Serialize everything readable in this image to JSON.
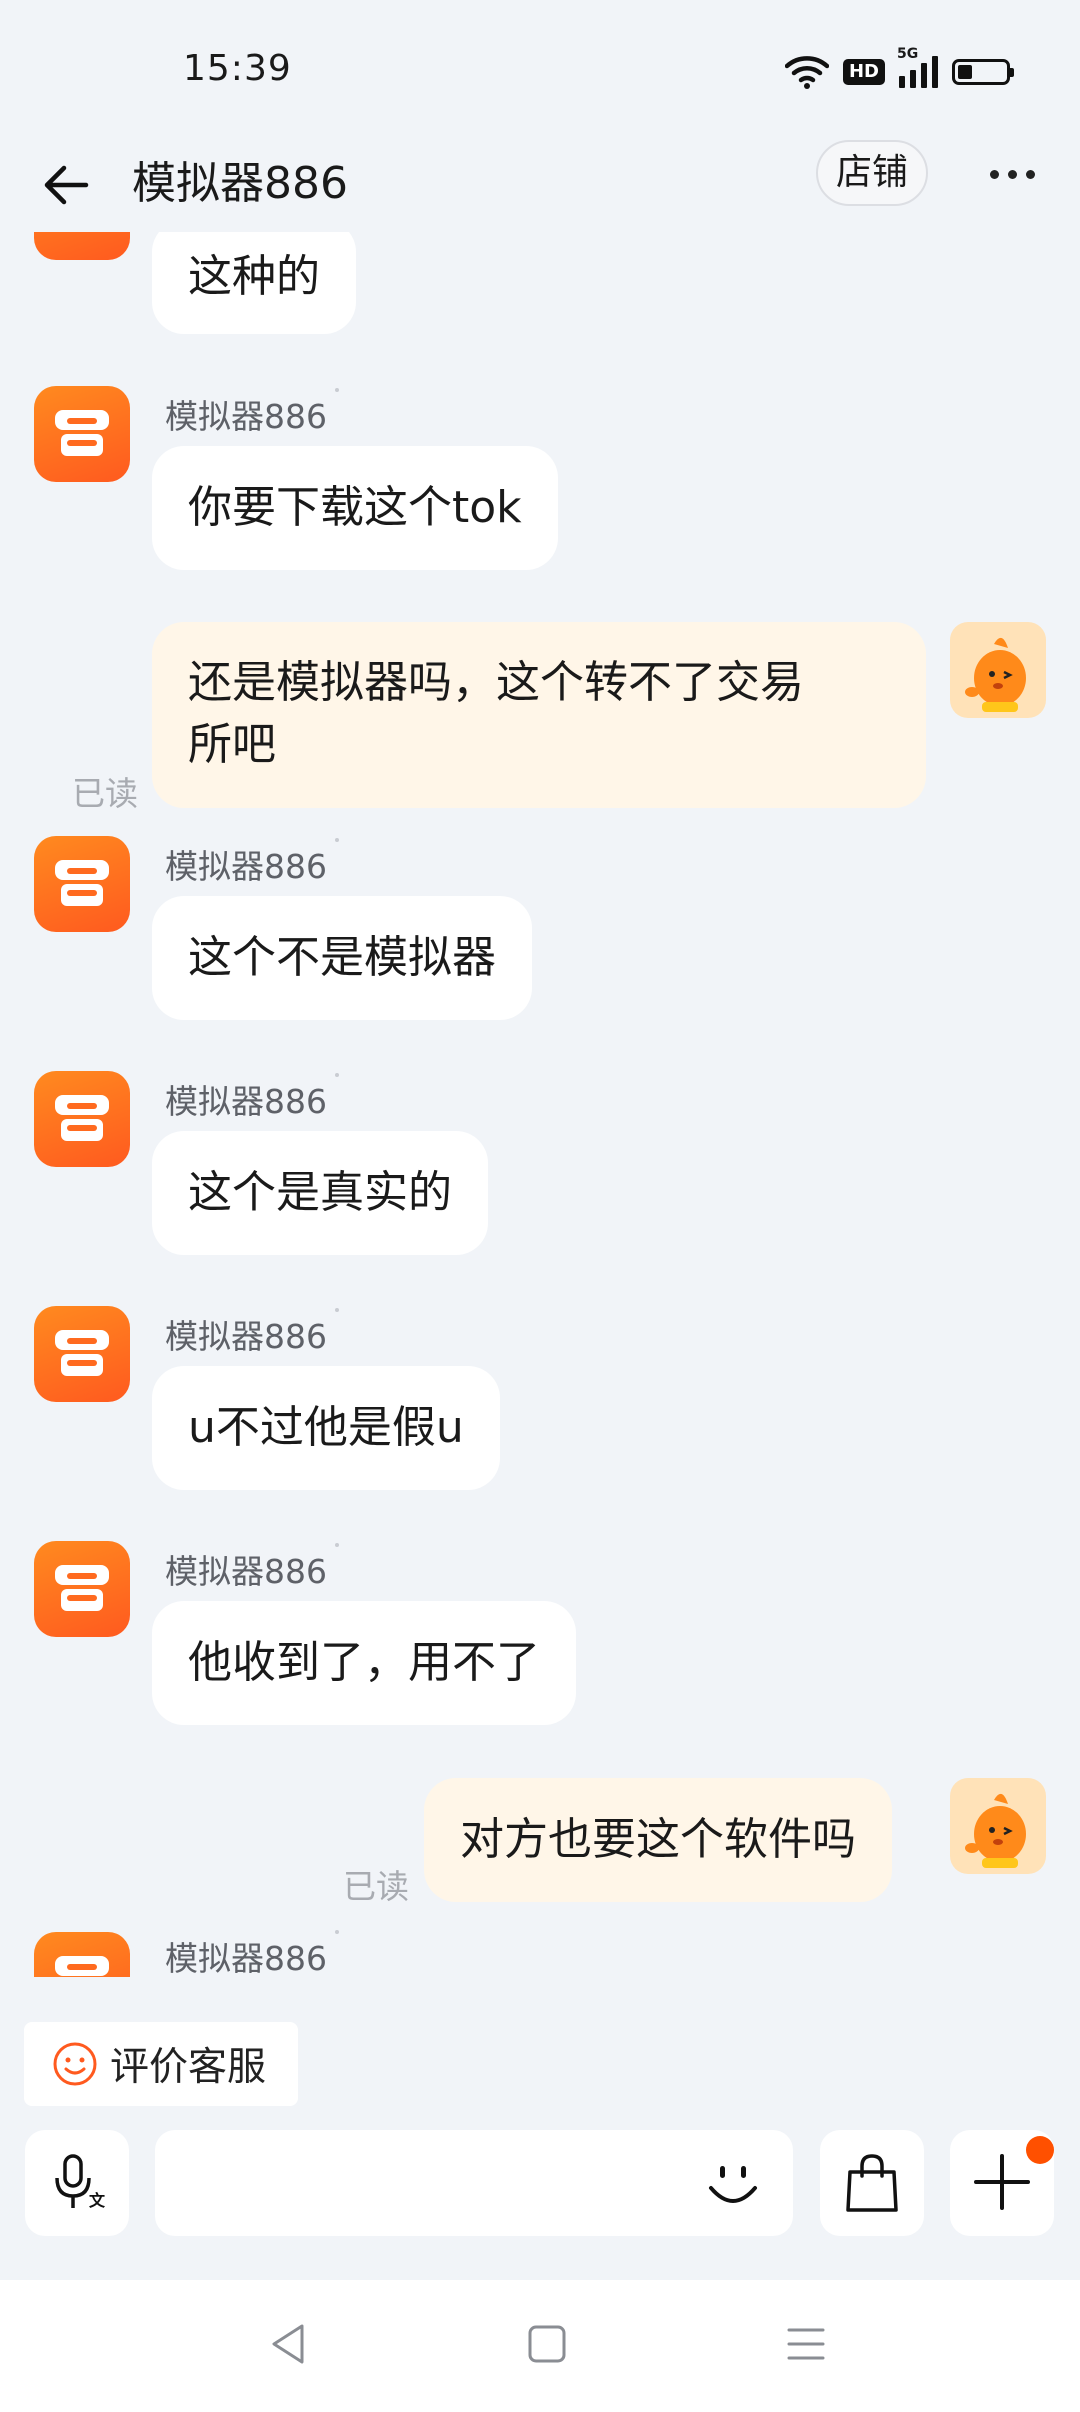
{
  "status_bar": {
    "time": "15:39",
    "network_badge": "HD",
    "network_gen": "5G",
    "icons": [
      "wifi-icon",
      "hd-icon",
      "signal-icon",
      "battery-icon"
    ]
  },
  "header": {
    "title": "模拟器886",
    "shop_button": "店铺",
    "back_icon": "arrow-left-icon",
    "more_icon": "more-icon"
  },
  "messages": [
    {
      "side": "in",
      "sender": "",
      "text": "这种的"
    },
    {
      "side": "in",
      "sender": "模拟器886",
      "text": "你要下载这个tok"
    },
    {
      "side": "out",
      "text_lines": [
        "还是模拟器吗，这个转不了交易",
        "所吧"
      ],
      "status": "已读"
    },
    {
      "side": "in",
      "sender": "模拟器886",
      "text": "这个不是模拟器"
    },
    {
      "side": "in",
      "sender": "模拟器886",
      "text": "这个是真实的"
    },
    {
      "side": "in",
      "sender": "模拟器886",
      "text": "u不过他是假u"
    },
    {
      "side": "in",
      "sender": "模拟器886",
      "text": "他收到了，用不了"
    },
    {
      "side": "out",
      "text": "对方也要这个软件吗",
      "status": "已读"
    },
    {
      "side": "in",
      "sender": "模拟器886",
      "text": ""
    }
  ],
  "rate_service": {
    "label": "评价客服",
    "icon": "smile-icon"
  },
  "input_bar": {
    "placeholder": "",
    "icons": [
      "voice-to-text-icon",
      "emoji-icon",
      "shopping-bag-icon",
      "plus-icon"
    ]
  },
  "nav_bar": {
    "icons": [
      "back-triangle-icon",
      "home-square-icon",
      "menu-lines-icon"
    ]
  },
  "colors": {
    "background": "#f1f4f8",
    "accent": "#ff5a1f",
    "outgoing_bubble": "#fff6e8",
    "incoming_bubble": "#ffffff",
    "badge": "#ff5000"
  }
}
